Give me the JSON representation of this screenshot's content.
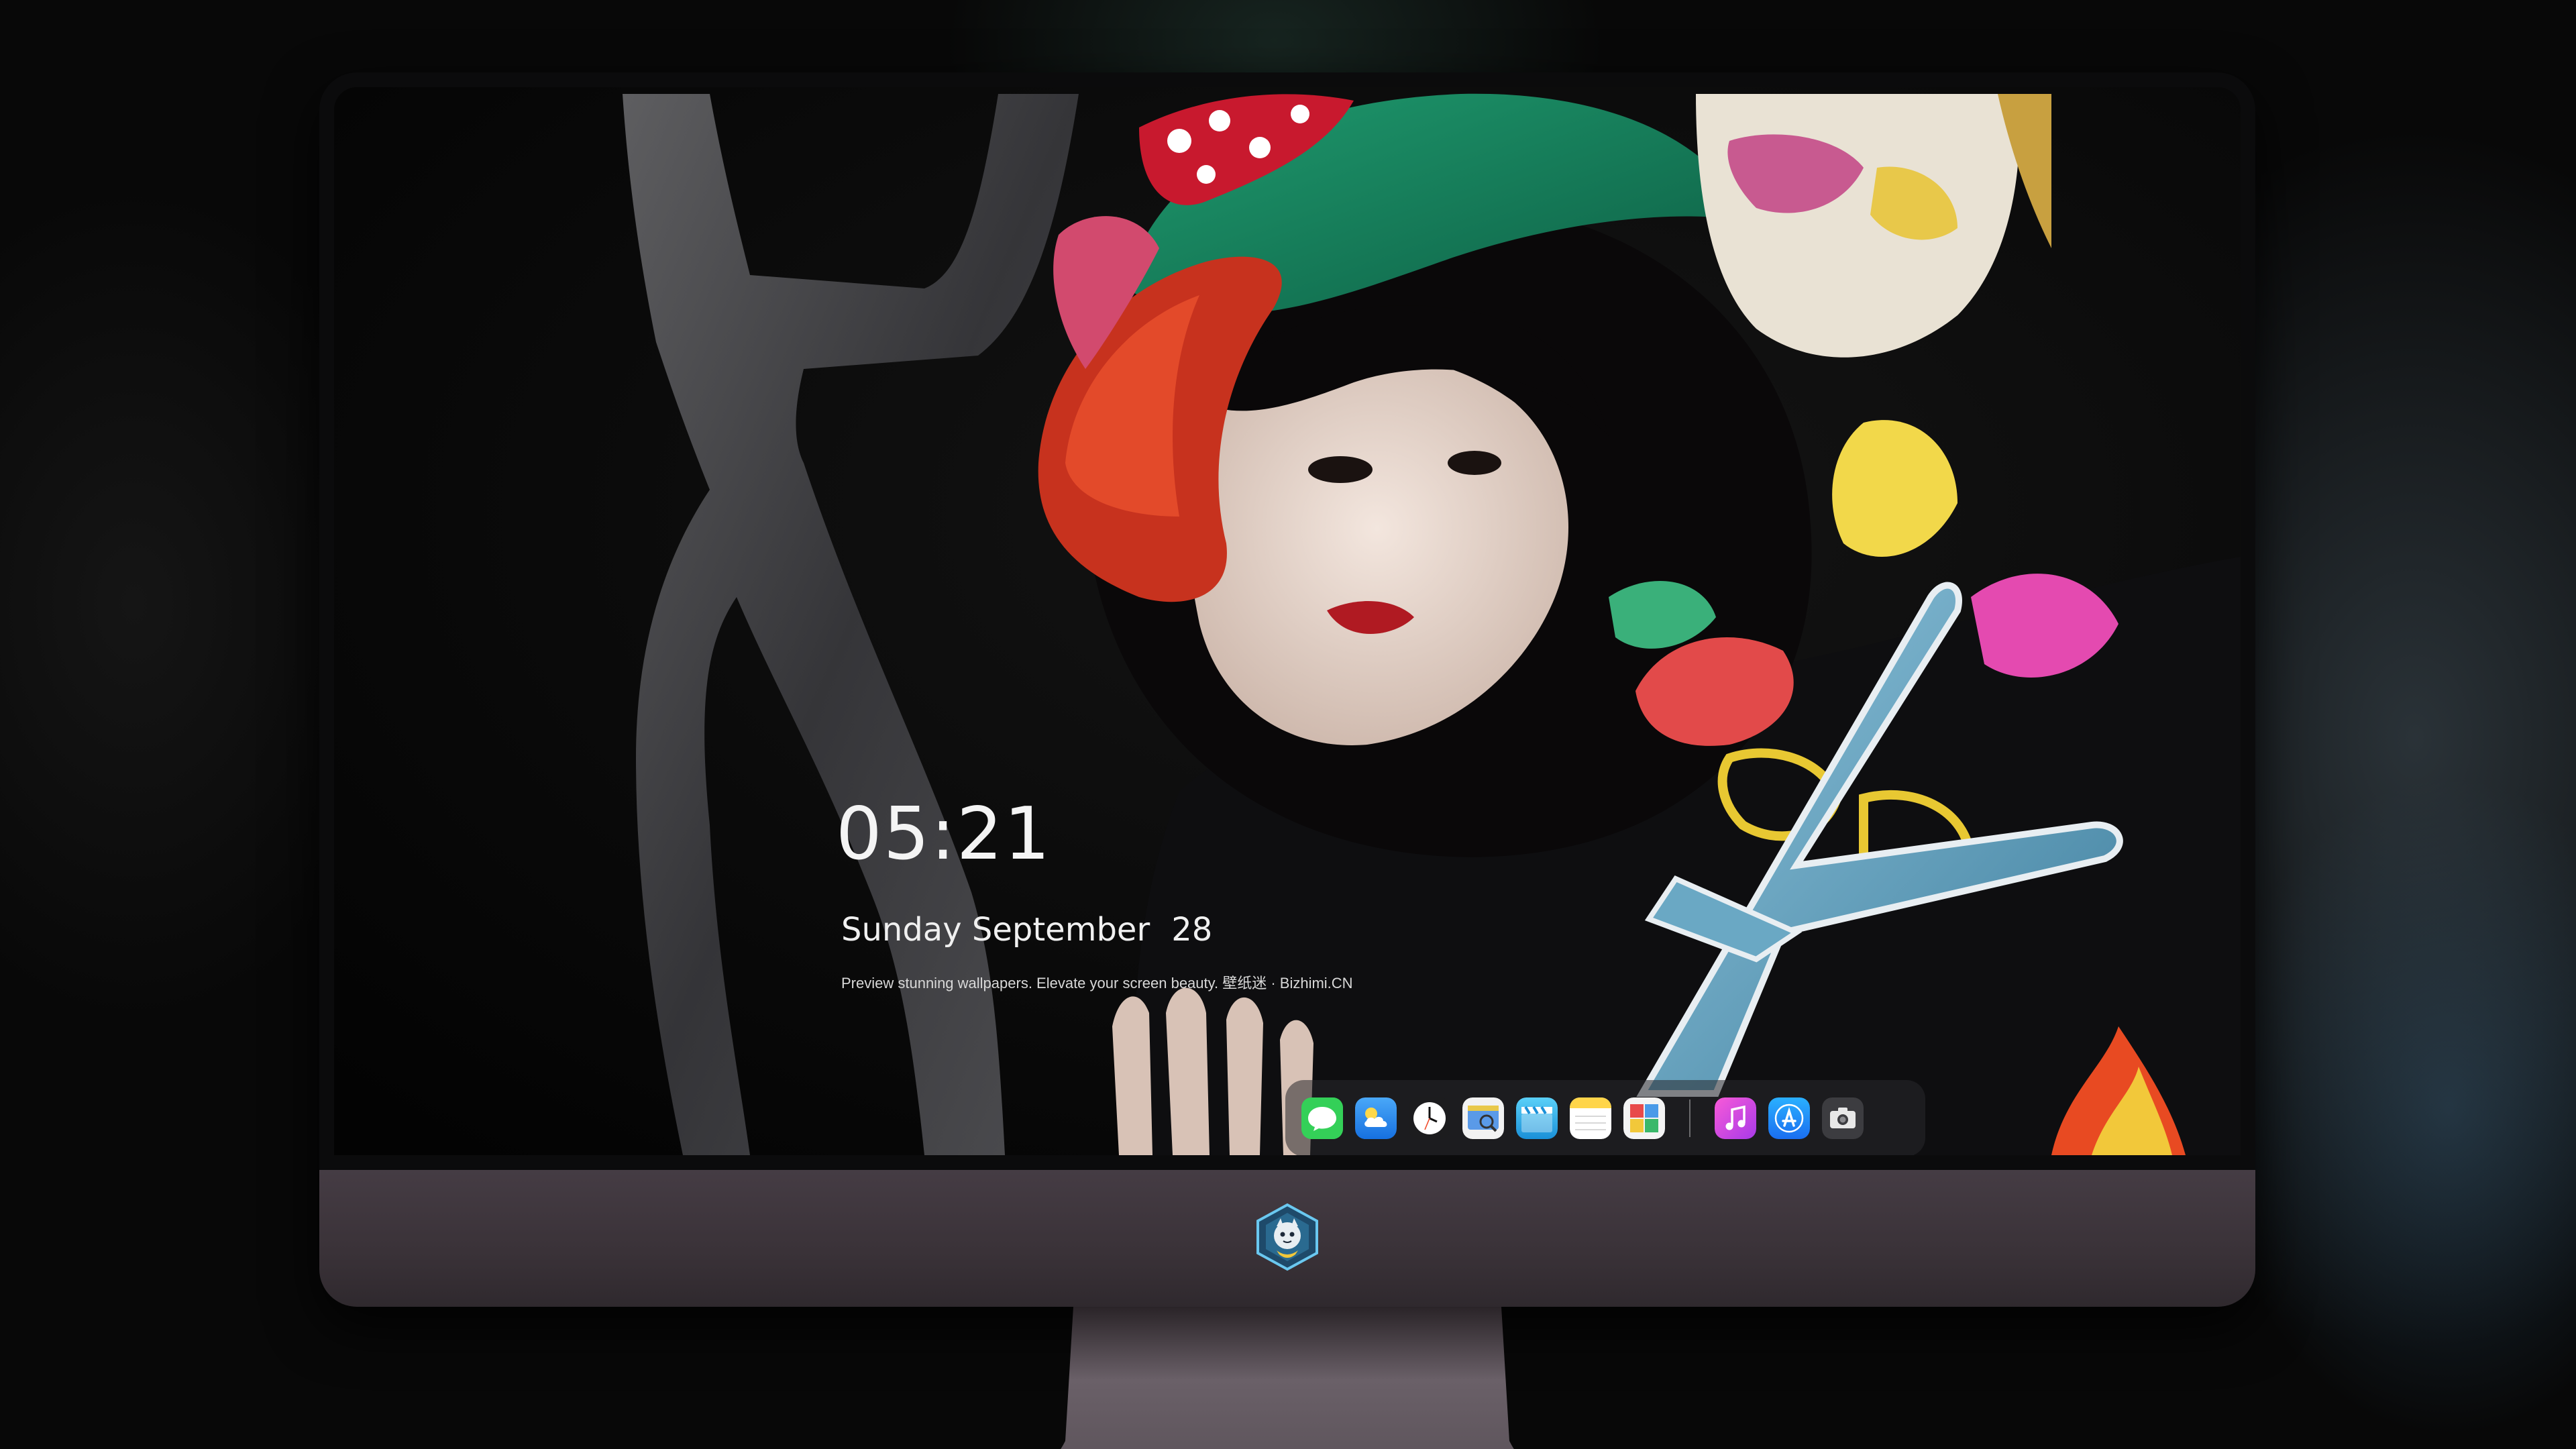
{
  "lockscreen": {
    "time": "05:21",
    "weekday": "Sunday",
    "month": "September",
    "day": "28",
    "tagline": "Preview stunning wallpapers. Elevate your screen beauty. 壁纸迷 · Bizhimi.CN"
  },
  "dock": {
    "apps": [
      {
        "name": "messages-icon",
        "color": "#32d74b"
      },
      {
        "name": "weather-icon",
        "color": "#2f8cf0"
      },
      {
        "name": "clock-icon",
        "color": "#ffffff"
      },
      {
        "name": "preview-icon",
        "color": "#4a8fe0"
      },
      {
        "name": "clips-icon",
        "color": "#38b8e8"
      },
      {
        "name": "notes-icon",
        "color": "#ffd54a"
      },
      {
        "name": "photo-booth-icon",
        "color": "#f0f0f0"
      },
      {
        "name": "itunes-icon",
        "color": "#e040c8"
      },
      {
        "name": "app-store-icon",
        "color": "#1a8cff"
      },
      {
        "name": "screenshot-icon",
        "color": "#3a3a3a"
      }
    ]
  },
  "colors": {
    "chin": "#3a3238",
    "bezel": "#0b0b0c",
    "stand": "#5a5158"
  }
}
